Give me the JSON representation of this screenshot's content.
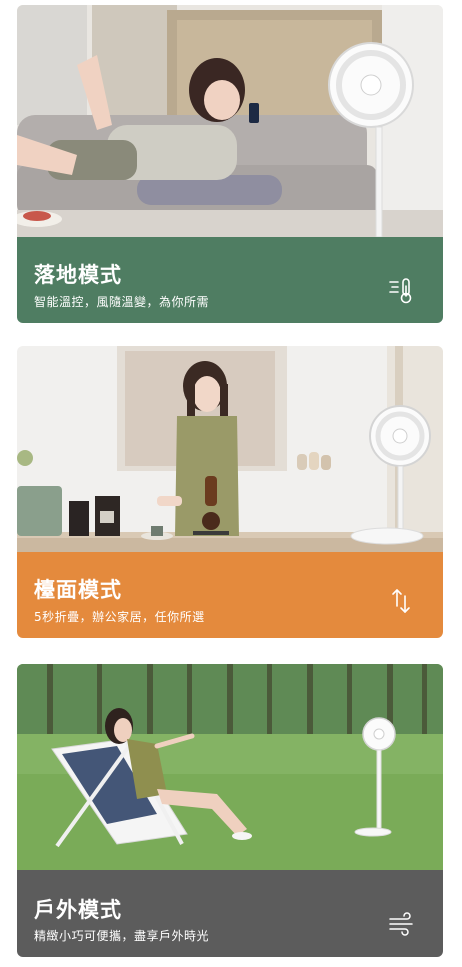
{
  "modes": [
    {
      "title": "落地模式",
      "subtitle": "智能溫控，風隨溫變，為你所需",
      "icon": "thermometer-wind-icon",
      "color": "#4f7d62"
    },
    {
      "title": "檯面模式",
      "subtitle": "5秒折疊，辦公家居，任你所選",
      "icon": "up-down-arrows-icon",
      "color": "#e48a3d"
    },
    {
      "title": "戶外模式",
      "subtitle": "精緻小巧可便攜，盡享戶外時光",
      "icon": "wind-icon",
      "color": "#5c5c5c"
    }
  ]
}
